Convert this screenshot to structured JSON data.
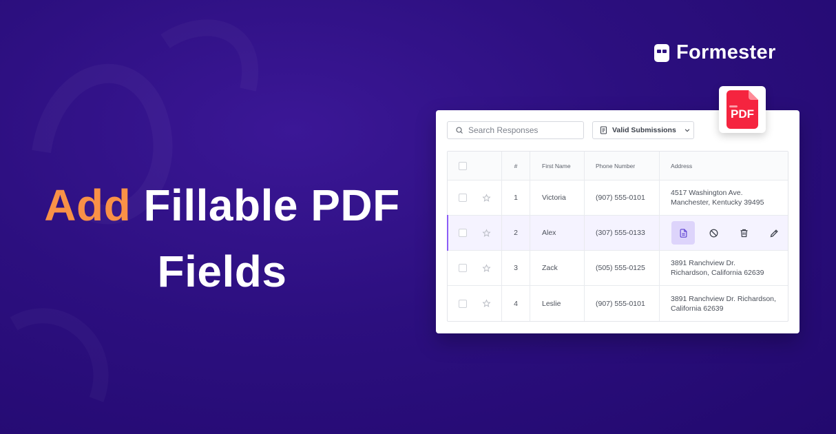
{
  "headline": {
    "accent": "Add",
    "line1_rest": "Fillable PDF",
    "line2": "Fields"
  },
  "brand": {
    "name": "Formester",
    "icon": "formester-logo-icon"
  },
  "pdf_badge": {
    "label": "PDF",
    "icon": "pdf-file-icon",
    "color": "#f5243f"
  },
  "search": {
    "placeholder": "Search Responses",
    "value": ""
  },
  "filter": {
    "label": "Valid Submissions",
    "icon": "document-icon"
  },
  "table": {
    "columns": [
      "#",
      "First Name",
      "Phone Number",
      "Address"
    ],
    "rows": [
      {
        "num": "1",
        "first_name": "Victoria",
        "phone": "(907) 555-0101",
        "address_line1": "4517 Washington Ave.",
        "address_line2": "Manchester, Kentucky 39495"
      },
      {
        "num": "2",
        "first_name": "Alex",
        "phone": "(307) 555-0133",
        "selected": true
      },
      {
        "num": "3",
        "first_name": "Zack",
        "phone": "(505) 555-0125",
        "address_line1": "3891 Ranchview Dr.",
        "address_line2": "Richardson, California 62639"
      },
      {
        "num": "4",
        "first_name": "Leslie",
        "phone": "(907) 555-0101",
        "address_line1": "3891 Ranchview Dr. Richardson,",
        "address_line2": "California 62639"
      }
    ],
    "row_actions": [
      "pdf-document-icon",
      "block-icon",
      "trash-icon",
      "edit-pencil-icon"
    ]
  },
  "colors": {
    "accent_orange": "#f99147",
    "background_purple": "#2c0f7f",
    "selected_row": "#f5f3ff",
    "selected_action": "#ddd4fb",
    "pdf_red": "#f5243f"
  }
}
